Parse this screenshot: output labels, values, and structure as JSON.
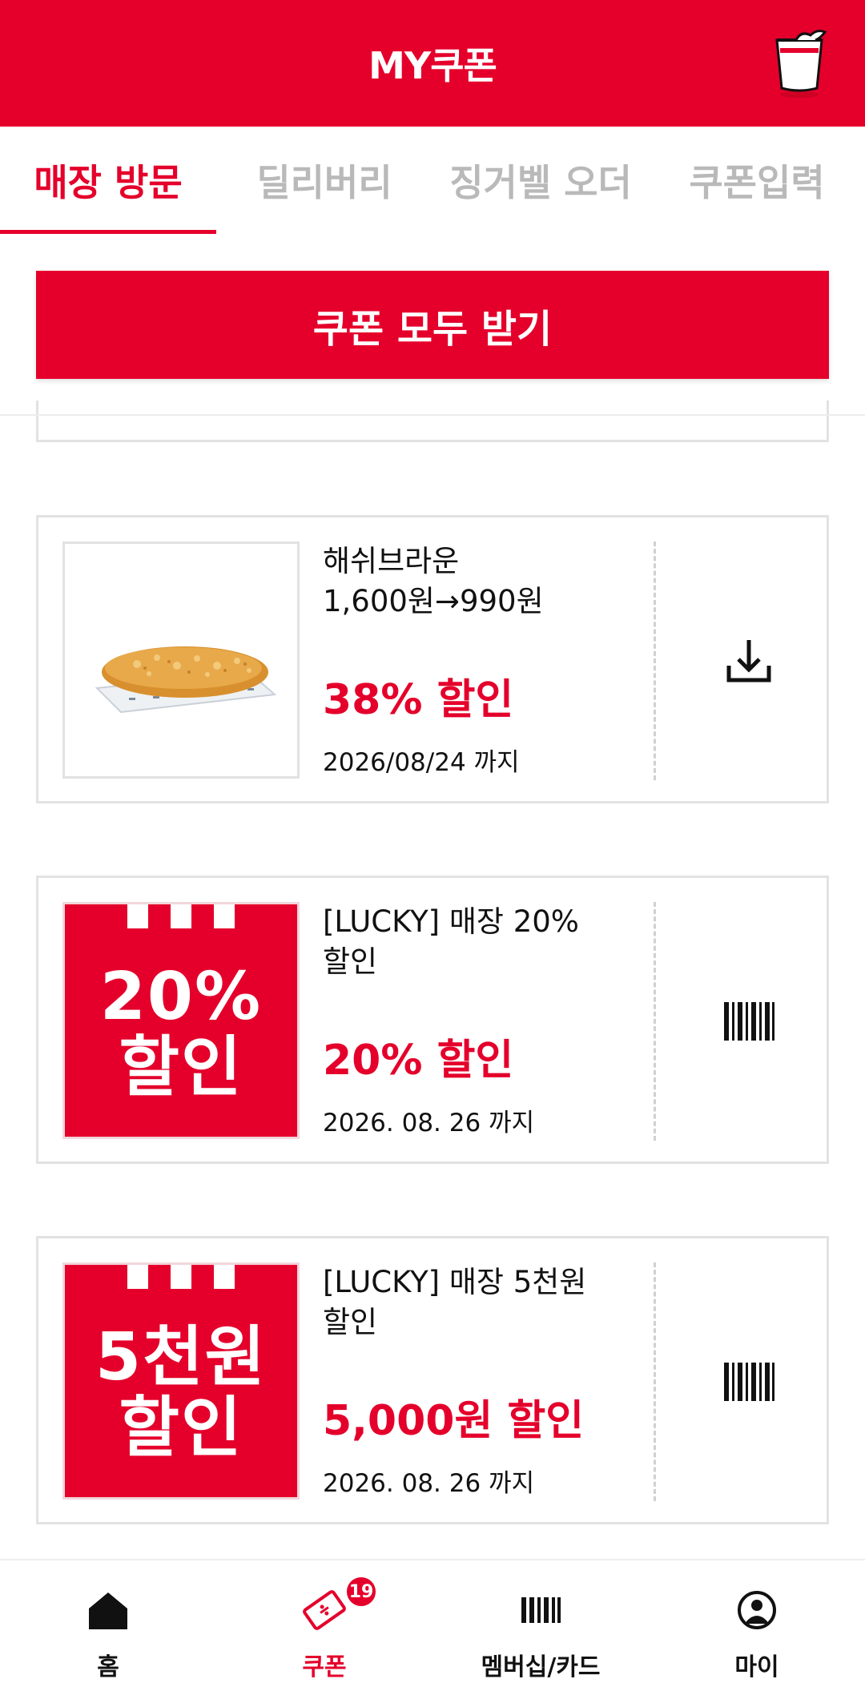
{
  "header": {
    "title": "MY쿠폰",
    "icon": "bucket-icon",
    "brand_color": "#e4002b"
  },
  "tabs": [
    {
      "label": "매장 방문",
      "active": true
    },
    {
      "label": "딜리버리",
      "active": false
    },
    {
      "label": "징거벨 오더",
      "active": false
    },
    {
      "label": "쿠폰입력",
      "active": false
    }
  ],
  "get_all_button": "쿠폰 모두 받기",
  "coupons": [
    {
      "image": "hash-brown-photo",
      "title": "해쉬브라운\n1,600원→990원",
      "discount": "38% 할인",
      "expiry": "2026/08/24 까지",
      "action_icon": "download-icon"
    },
    {
      "image_text": "20%\n할인",
      "title": "[LUCKY] 매장 20%\n할인",
      "discount": "20% 할인",
      "expiry": "2026. 08. 26 까지",
      "action_icon": "barcode-icon"
    },
    {
      "image_text": "5천원\n할인",
      "title": "[LUCKY] 매장 5천원\n할인",
      "discount": "5,000원 할인",
      "expiry": "2026. 08. 26 까지",
      "action_icon": "barcode-icon"
    }
  ],
  "bottom_nav": [
    {
      "label": "홈",
      "icon": "home-icon",
      "active": false
    },
    {
      "label": "쿠폰",
      "icon": "coupon-icon",
      "active": true,
      "badge": "19"
    },
    {
      "label": "멤버십/카드",
      "icon": "barcode-icon",
      "active": false
    },
    {
      "label": "마이",
      "icon": "user-icon",
      "active": false
    }
  ]
}
